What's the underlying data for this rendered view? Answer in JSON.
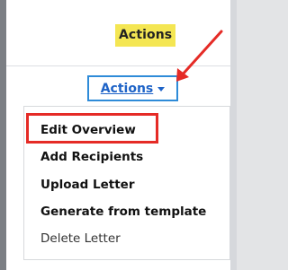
{
  "header": {
    "column_label": "Actions"
  },
  "actions_button": {
    "label": "Actions",
    "caret_icon": "caret-down-icon"
  },
  "menu": {
    "items": [
      {
        "label": "Edit Overview",
        "style": "bold",
        "highlighted": true
      },
      {
        "label": "Add Recipients",
        "style": "bold"
      },
      {
        "label": "Upload Letter",
        "style": "bold"
      },
      {
        "label": "Generate from template",
        "style": "bold"
      },
      {
        "label": "Delete Letter",
        "style": "normal"
      }
    ]
  },
  "annotations": {
    "arrow_color": "#e52b26",
    "highlight_color": "#e52b26",
    "header_highlight_color": "#f4e653",
    "link_color": "#1e63c7",
    "button_border_color": "#2e8bd8"
  }
}
